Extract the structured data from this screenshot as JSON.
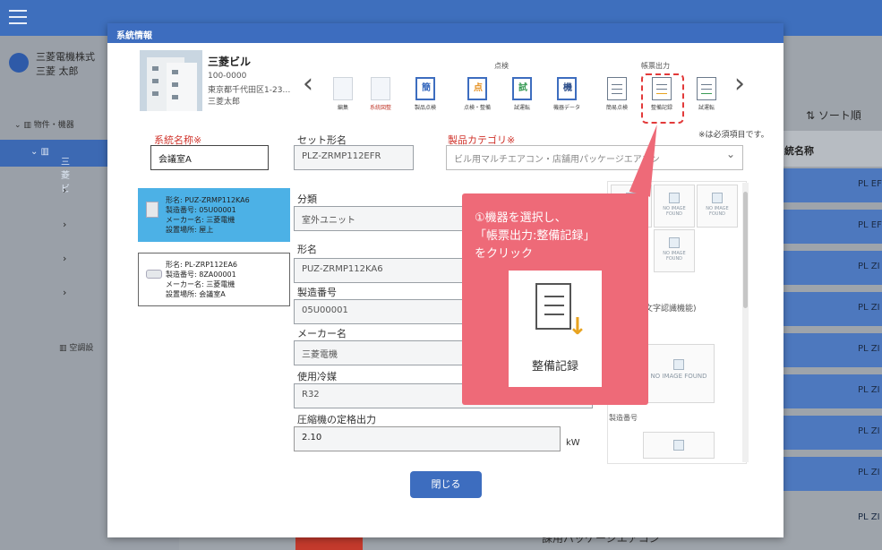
{
  "app": {
    "company": "三菱電機株式",
    "user": "三菱 太郎",
    "tree_header": "物件・機器",
    "tree_selected": "三菱ビ",
    "tree_bottom": "空調設",
    "sort_label": "⇅ ソート順",
    "column_header": "統名称",
    "row_cells": [
      "PL EF",
      "PL EF",
      "PL ZI",
      "PL ZI",
      "PL ZI",
      "PL ZI",
      "PL ZI",
      "PL ZI",
      "PL ZI"
    ],
    "bottom_text": "課用パッケージエアコン"
  },
  "modal": {
    "title": "系統情報",
    "building": {
      "name": "三菱ビル",
      "zip": "100-0000",
      "address": "東京都千代田区1-23…",
      "owner": "三菱太郎"
    },
    "groups": {
      "inspection": "点検",
      "report": "帳票出力"
    },
    "tools": [
      {
        "name": "edit-tool",
        "caption": "編集",
        "glyph": ""
      },
      {
        "name": "system-diagram-tool",
        "caption": "系統図整",
        "glyph": "",
        "red": true
      },
      {
        "name": "pre-inspection-tool",
        "caption": "製品点検",
        "glyph": "簡"
      },
      {
        "name": "inspection-maintenance-tool",
        "caption": "点検・整備",
        "glyph": "点"
      },
      {
        "name": "test-run-tool",
        "caption": "試運転",
        "glyph": "試"
      },
      {
        "name": "device-data-tool",
        "caption": "機器データ",
        "glyph": "機"
      },
      {
        "name": "simple-inspection-report-tool",
        "caption": "簡易点検",
        "glyph": ""
      },
      {
        "name": "maintenance-record-report-tool",
        "caption": "整備記録",
        "glyph": ""
      },
      {
        "name": "test-run-report-tool",
        "caption": "試運転",
        "glyph": ""
      }
    ],
    "required_note": "※は必須項目です。",
    "labels": {
      "system_name": "系統名称※",
      "set_model": "セット形名",
      "product_category": "製品カテゴリ※",
      "classification": "分類",
      "model": "形名",
      "serial": "製造番号",
      "maker": "メーカー名",
      "refrigerant": "使用冷媒",
      "compressor_output": "圧縮機の定格出力"
    },
    "values": {
      "system_name": "会議室A",
      "set_model": "PLZ-ZRMP112EFR",
      "product_category": "ビル用マルチエアコン・店舗用パッケージエアコン",
      "classification": "室外ユニット",
      "model": "PUZ-ZRMP112KA6",
      "serial": "05U00001",
      "maker": "三菱電機",
      "refrigerant": "R32",
      "compressor_output": "2.10",
      "compressor_unit": "kW"
    },
    "devices": [
      {
        "line1": "形名: PUZ-ZRMP112KA6",
        "line2": "製造番号: 05U00001",
        "line3": "メーカー名: 三菱電機",
        "line4": "設置場所: 屋上"
      },
      {
        "line1": "形名: PL-ZRP112EA6",
        "line2": "製造番号: 8ZA00001",
        "line3": "メーカー名: 三菱電機",
        "line4": "設置場所: 会議室A"
      }
    ],
    "no_image": "NO IMAGE FOUND",
    "ocr_label": "文字認識機能)",
    "serial_label": "製造番号",
    "close_button": "閉じる"
  },
  "callout": {
    "line1": "①機器を選択し、",
    "line2": "「帳票出力:整備記録」",
    "line3": "をクリック",
    "icon_caption": "整備記録"
  }
}
